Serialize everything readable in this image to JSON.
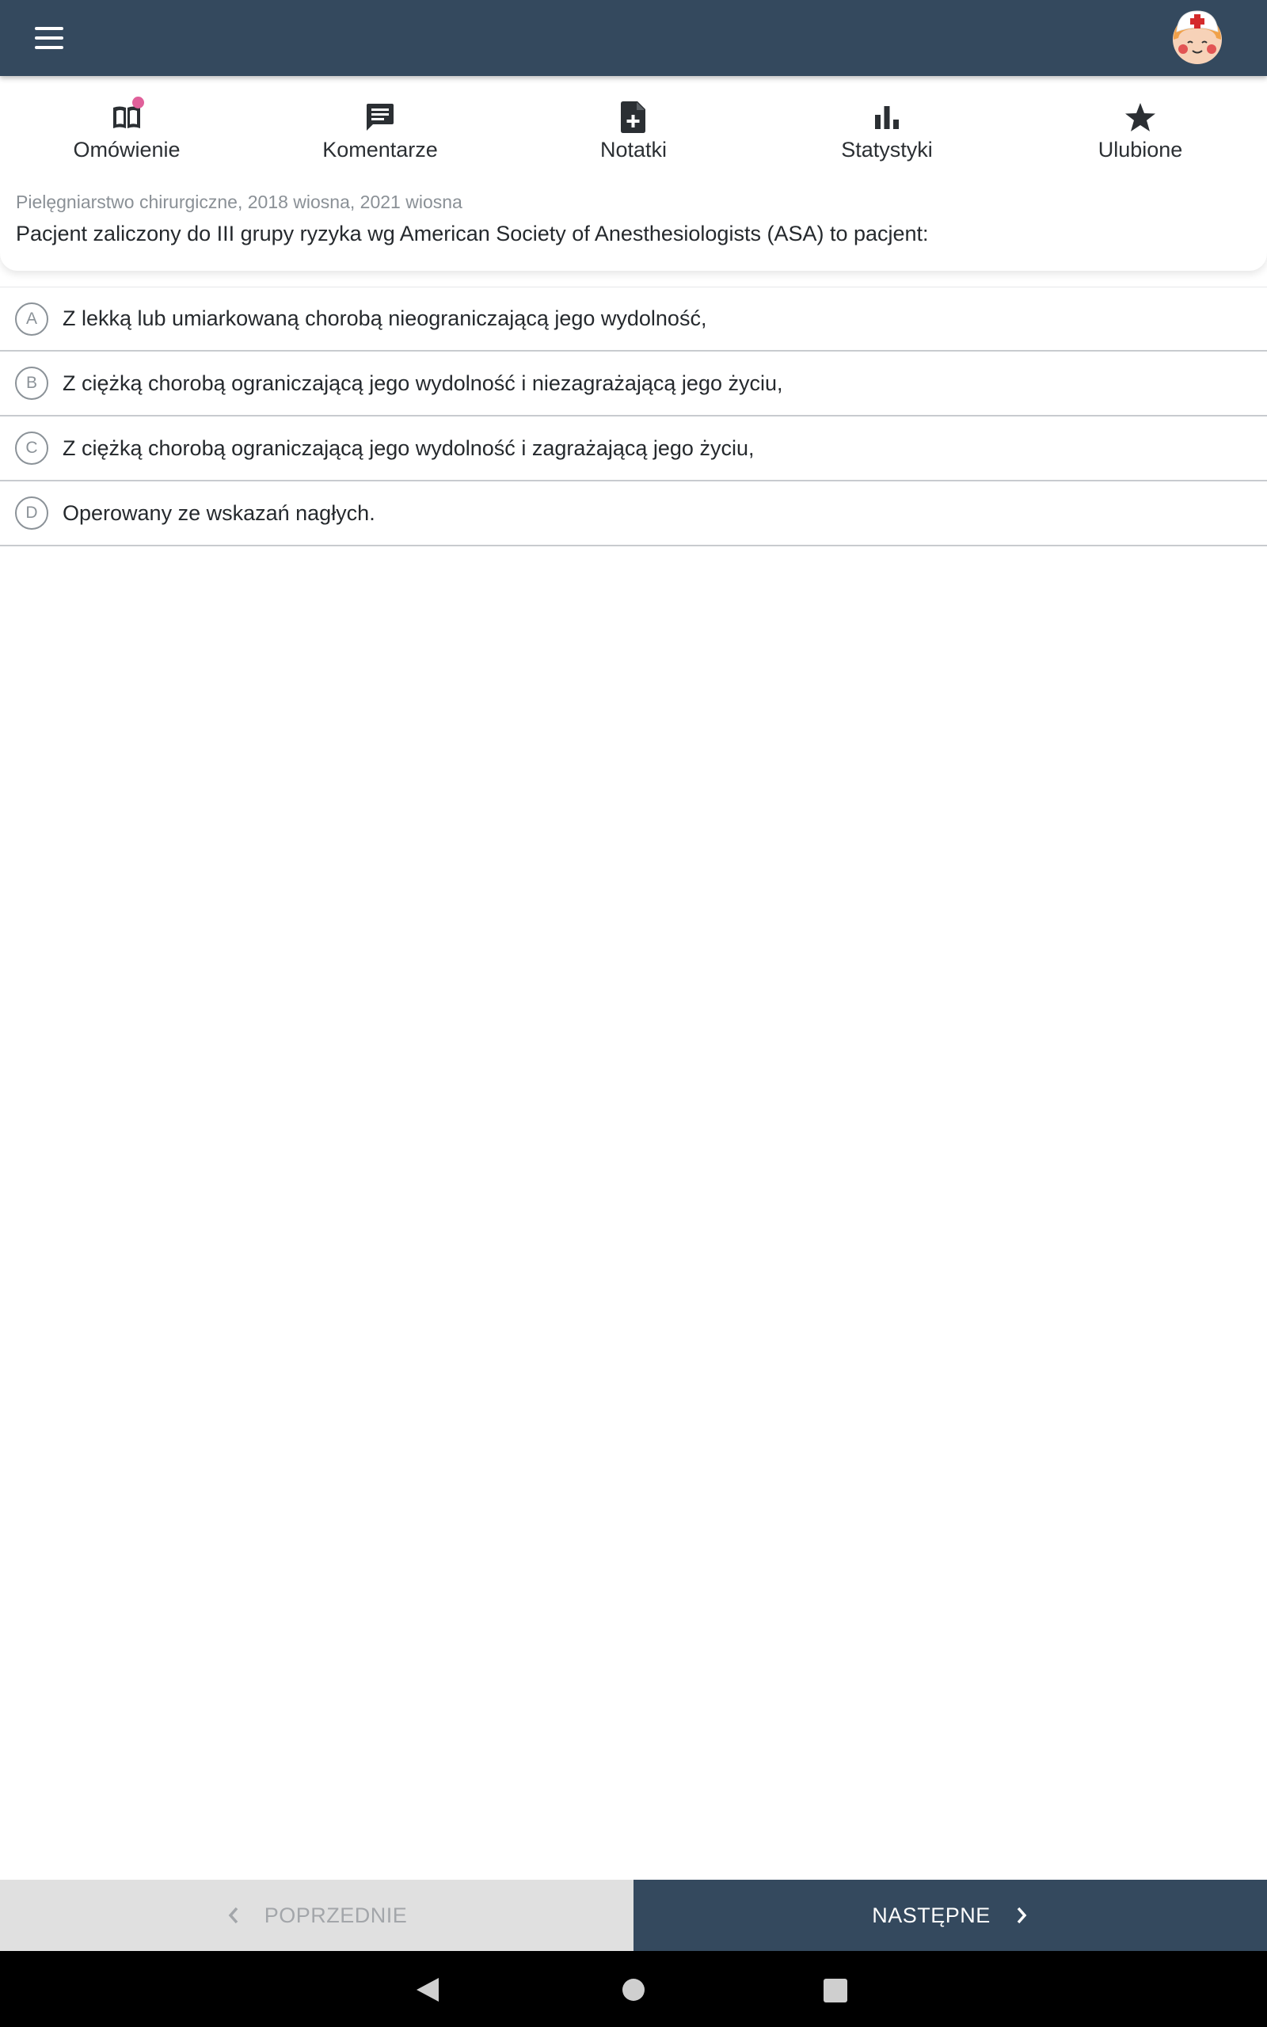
{
  "header": {
    "menu_icon": "menu-icon",
    "avatar_icon": "nurse-avatar"
  },
  "tabs": [
    {
      "label": "Omówienie",
      "icon": "book-icon",
      "has_dot": true
    },
    {
      "label": "Komentarze",
      "icon": "comment-icon"
    },
    {
      "label": "Notatki",
      "icon": "note-add-icon"
    },
    {
      "label": "Statystyki",
      "icon": "bar-chart-icon"
    },
    {
      "label": "Ulubione",
      "icon": "star-icon"
    }
  ],
  "question": {
    "category": "Pielęgniarstwo chirurgiczne, 2018 wiosna, 2021 wiosna",
    "text": "Pacjent zaliczony do III grupy ryzyka wg American Society of Anesthesiologists (ASA) to pacjent:"
  },
  "answers": [
    {
      "letter": "A",
      "text": "Z lekką lub umiarkowaną chorobą nieograniczającą jego wydolność,"
    },
    {
      "letter": "B",
      "text": "Z ciężką chorobą ograniczającą jego wydolność i niezagrażającą jego życiu,"
    },
    {
      "letter": "C",
      "text": "Z ciężką chorobą ograniczającą jego wydolność i zagrażającą jego życiu,"
    },
    {
      "letter": "D",
      "text": "Operowany ze wskazań nagłych."
    }
  ],
  "navigation": {
    "prev_label": "POPRZEDNIE",
    "next_label": "NASTĘPNE"
  },
  "colors": {
    "header": "#34495e",
    "notification_dot": "#e0609a",
    "prev_button": "#e0e0e0"
  }
}
